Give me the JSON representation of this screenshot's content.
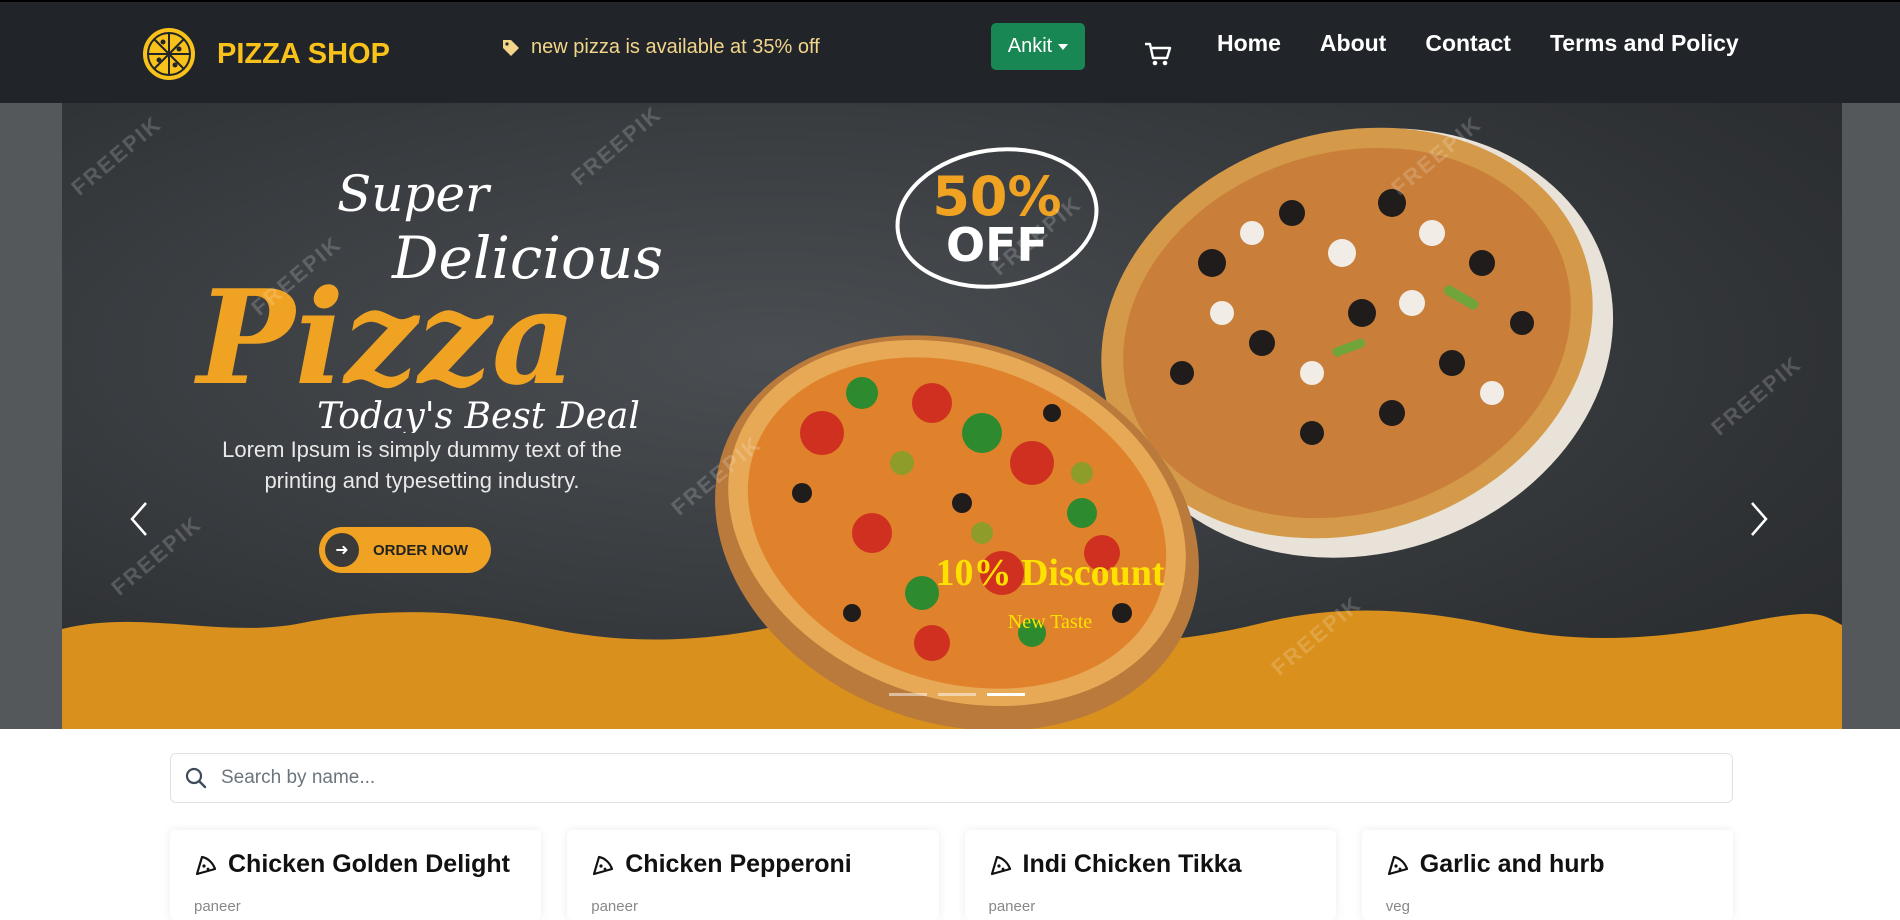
{
  "navbar": {
    "brand": "PIZZA SHOP",
    "promo": "new pizza is available at 35% off",
    "user_button": "Ankit",
    "links": [
      "Home",
      "About",
      "Contact",
      "Terms and Policy"
    ]
  },
  "carousel": {
    "headline_super": "Super",
    "headline_delicious": "Delicious",
    "headline_pizza": "Pizza",
    "headline_deal": "Today's Best Deal",
    "lorem_line1": "Lorem Ipsum is simply dummy text of the",
    "lorem_line2": "printing and typesetting industry.",
    "order_button": "ORDER NOW",
    "badge_line1": "50%",
    "badge_line2": "OFF",
    "caption_title": "10% Discount",
    "caption_sub": "New Taste",
    "watermark": "FREEPIK",
    "active_slide": 3,
    "slide_count": 3
  },
  "search": {
    "placeholder": "Search by name..."
  },
  "cards": [
    {
      "title": "Chicken Golden Delight",
      "sub": "paneer"
    },
    {
      "title": "Chicken Pepperoni",
      "sub": "paneer"
    },
    {
      "title": "Indi Chicken Tikka",
      "sub": "paneer"
    },
    {
      "title": "Garlic and hurb",
      "sub": "veg"
    }
  ],
  "colors": {
    "navbar": "#212529",
    "brand": "#f8c21b",
    "user_button": "#198754",
    "accent": "#f0a323",
    "caption": "#ffe100"
  }
}
